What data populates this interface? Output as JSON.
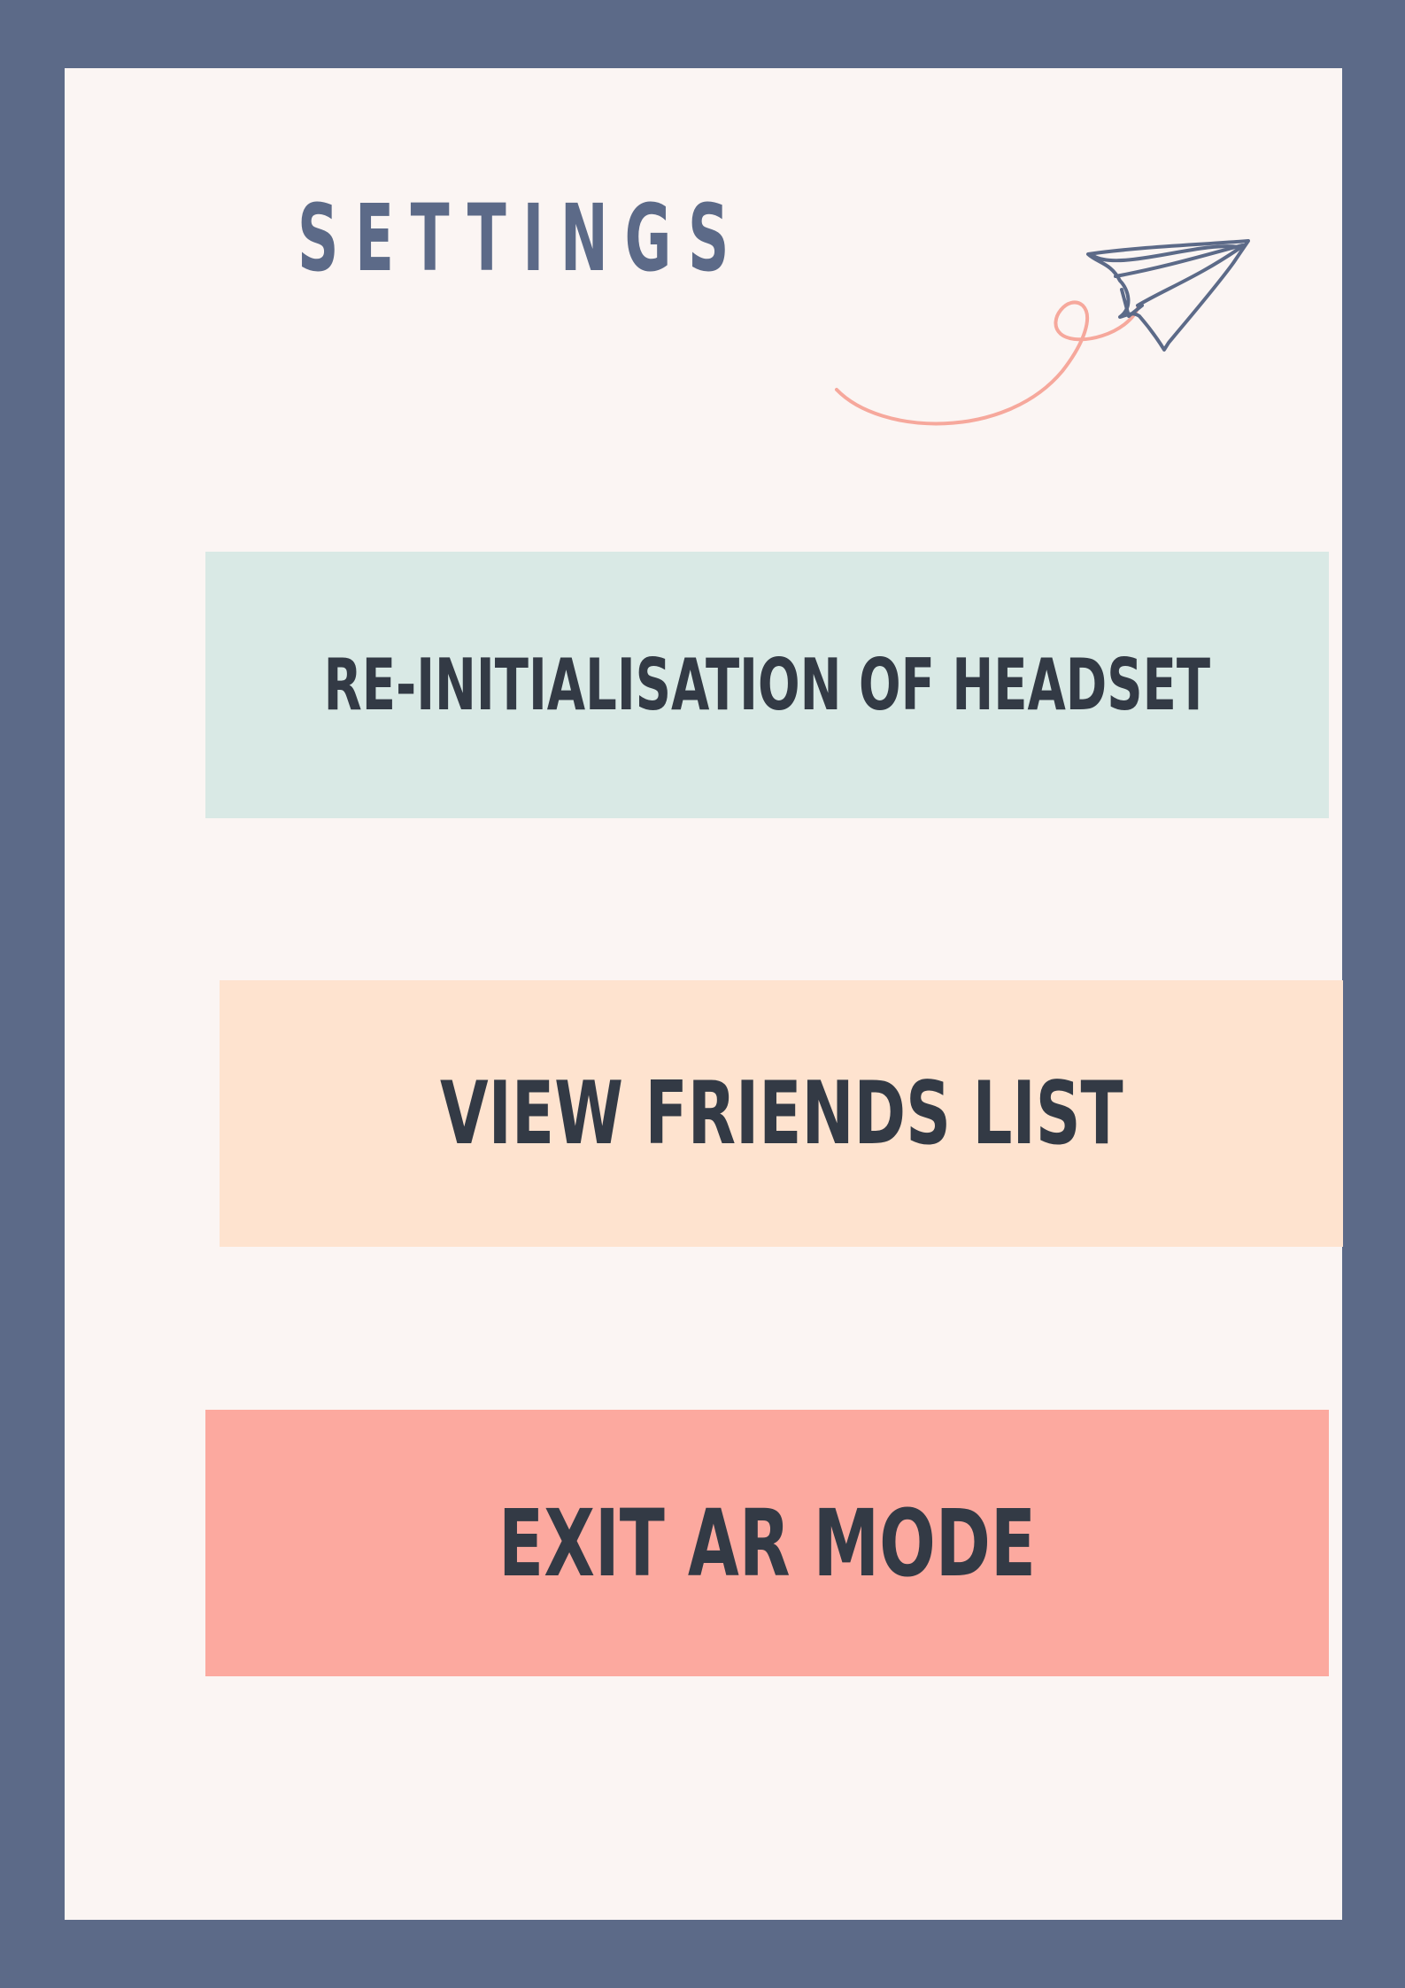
{
  "settings": {
    "title": "SETTINGS"
  },
  "menu": {
    "items": [
      {
        "label": "RE-INITIALISATION OF HEADSET"
      },
      {
        "label": "VIEW FRIENDS LIST"
      },
      {
        "label": "EXIT AR MODE"
      }
    ]
  },
  "icons": {
    "decoration": "paper-plane-icon"
  },
  "colors": {
    "border": "#5c6a88",
    "background": "#fbf5f3",
    "title": "#5c6a88",
    "button_text": "#333a45",
    "reinit_button": "#d9e9e5",
    "friends_button": "#fee3cf",
    "exit_button": "#fca99f",
    "flight_trail": "#f6a89c"
  }
}
